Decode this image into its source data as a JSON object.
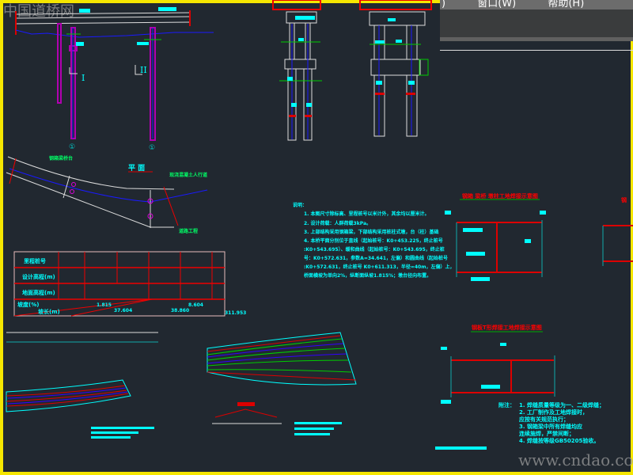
{
  "watermark_top": "中国道桥网",
  "watermark_bottom": "www.cndao.com",
  "menu": {
    "items": [
      ")",
      "窗口(W)",
      "帮助(H)"
    ]
  },
  "elevation": {
    "section_marks": [
      "I",
      "II"
    ],
    "pier_labels": [
      "①",
      "①"
    ]
  },
  "plan": {
    "title": "平  面",
    "labels": [
      "钢箱梁桥台",
      "现浇混凝土人行道",
      "道路工程"
    ]
  },
  "notes": {
    "title": "说明：",
    "lines": [
      "1. 本图尺寸除标高、里程桩号以米计外，其余均以厘米计。",
      "2. 设计荷载：人群荷载3kPa。",
      "3. 上部结构采用钢箱梁，下部结构采用桩柱式墩，台（柱）基础",
      "4. 本桥平面分别位于直线（起始桩号：K0+453.225，终止桩号",
      "   :K0+543.695）、缓和曲线（起始桩号：K0+543.695，终止桩",
      "   号：K0+572.631，参数A=34.641，左偏）和圆曲线（起始桩号",
      "   :K0+572.631，终止桩号 K0+611.313，半径=40m，左偏）上，",
      "   桥面横坡为单向2%，纵断面纵坡1.815%；墩台径向布置。"
    ]
  },
  "profile_table": {
    "row_headers": [
      "里程桩号",
      "设计高程(m)",
      "地面高程(m)",
      "坡度(%)",
      "坡长(m)"
    ],
    "values": [
      "1.815",
      "37.604",
      "8.604",
      "38.860",
      "311.953"
    ]
  },
  "detail1": {
    "title": "钢箱 梁桥 墩柱工地焊接示意图"
  },
  "detail2": {
    "title": "钢板T形焊接工地焊接示意图"
  },
  "detail_notes": {
    "title": "附注：",
    "lines": [
      "1. 焊缝质量等级为一、二级焊缝；",
      "2. 工厂制作及工地焊接时，",
      "   应按有关规范执行；",
      "3. 钢箱梁中所有焊缝均应",
      "   连续施焊，严禁间断；",
      "4. 焊缝按等级GB50205验收。"
    ]
  },
  "colors": {
    "background": "#212830",
    "frame": "#f5e600",
    "cyan": "#00ffff",
    "red": "#ff0000",
    "green": "#00d000",
    "blue": "#1010ff",
    "magenta": "#b000b0"
  }
}
